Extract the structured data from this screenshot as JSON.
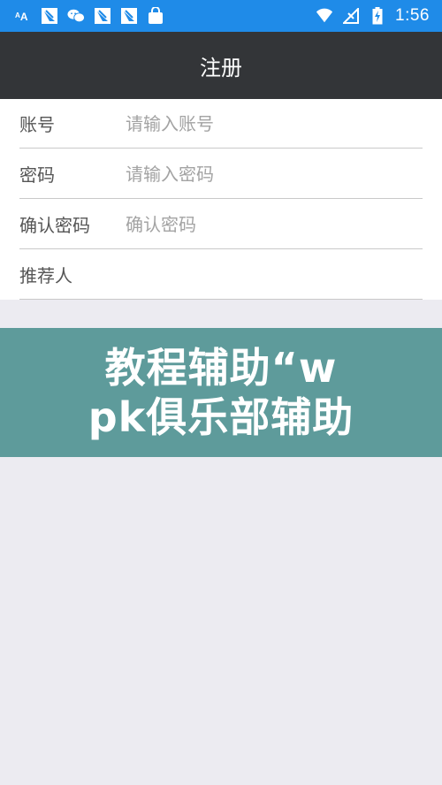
{
  "status_bar": {
    "time": "1:56",
    "left_icons": [
      "font-a-icon",
      "image-notification-icon",
      "wechat-icon",
      "image-notification-icon",
      "image-notification-icon",
      "shopping-bag-icon"
    ],
    "right_icons": [
      "wifi-icon",
      "no-signal-icon",
      "battery-charging-icon"
    ],
    "color": "#1f8be8"
  },
  "app_bar": {
    "title": "注册",
    "color": "#333538"
  },
  "form": {
    "rows": [
      {
        "label": "账号",
        "placeholder": "请输入账号"
      },
      {
        "label": "密码",
        "placeholder": "请输入密码"
      },
      {
        "label": "确认密码",
        "placeholder": "确认密码"
      },
      {
        "label": "推荐人",
        "placeholder": ""
      }
    ]
  },
  "banner": {
    "line1": "教程辅助“w",
    "line2": "pk俱乐部辅助",
    "color": "#5e9b9b"
  }
}
